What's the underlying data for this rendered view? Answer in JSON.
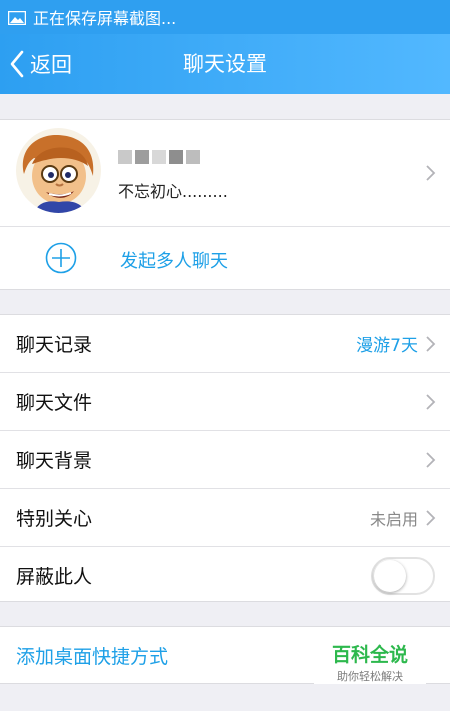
{
  "status_bar": {
    "text": "正在保存屏幕截图..."
  },
  "nav": {
    "back_label": "返回",
    "title": "聊天设置"
  },
  "profile": {
    "signature": "不忘初心.........",
    "avatar_alt": "cartoon-avatar"
  },
  "group_chat": {
    "label": "发起多人聊天"
  },
  "settings": [
    {
      "label": "聊天记录",
      "value": "漫游7天"
    },
    {
      "label": "聊天文件",
      "value": ""
    },
    {
      "label": "聊天背景",
      "value": ""
    },
    {
      "label": "特别关心",
      "value": "未启用"
    },
    {
      "label": "屏蔽此人",
      "value": ""
    }
  ],
  "block_toggle": {
    "on": false
  },
  "shortcut": {
    "label": "添加桌面快捷方式"
  },
  "watermark": {
    "title": "百科全说",
    "subtitle": "助你轻松解决"
  },
  "colors": {
    "accent": "#1ea0e7",
    "nav_start": "#2d9ff1",
    "nav_end": "#52b8ff",
    "watermark": "#2db84d"
  }
}
